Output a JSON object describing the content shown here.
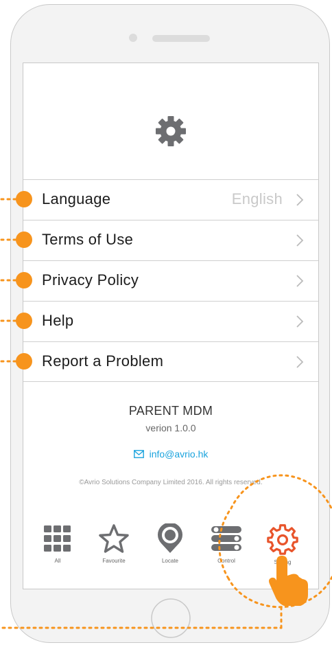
{
  "settings": {
    "items": [
      {
        "label": "Language",
        "value": "English"
      },
      {
        "label": "Terms of Use",
        "value": ""
      },
      {
        "label": "Privacy Policy",
        "value": ""
      },
      {
        "label": "Help",
        "value": ""
      },
      {
        "label": "Report a Problem",
        "value": ""
      }
    ]
  },
  "about": {
    "app_name": "PARENT MDM",
    "version": "verion 1.0.0",
    "email": "info@avrio.hk",
    "copyright": "©Avrio Solutions Company Limited 2016. All rights reserved."
  },
  "tabbar": {
    "tabs": [
      {
        "label": "All",
        "icon": "grid-icon"
      },
      {
        "label": "Favourite",
        "icon": "star-icon"
      },
      {
        "label": "Locate",
        "icon": "location-pin-icon"
      },
      {
        "label": "Control",
        "icon": "toggle-switches-icon"
      },
      {
        "label": "Setting",
        "icon": "gear-icon"
      }
    ]
  },
  "colors": {
    "accent": "#f7941d",
    "setting_active": "#e8542b",
    "link": "#1aa3dd",
    "icon_gray": "#6d6e71"
  }
}
